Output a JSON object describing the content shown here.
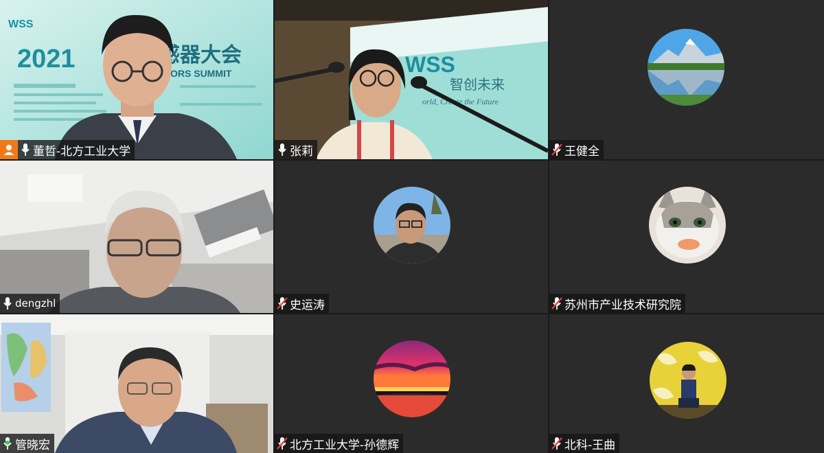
{
  "tiles": [
    {
      "id": "t1",
      "name": "董哲-北方工业大学",
      "mic": "on",
      "host": true,
      "backdrop": {
        "logo": "WSS",
        "year": "2021",
        "title_fragment": "感器大会",
        "subtitle_fragment": "ORS SUMMIT"
      }
    },
    {
      "id": "t2",
      "name": "张莉",
      "mic": "on",
      "backdrop": {
        "logo": "WSS",
        "slogan": "智创未来",
        "slogan_en": "orld, Create the Future"
      }
    },
    {
      "id": "t3",
      "name": "王健全",
      "mic": "muted",
      "avatar": "mountain-lake"
    },
    {
      "id": "t4",
      "name": "dengzhl",
      "mic": "on"
    },
    {
      "id": "t5",
      "name": "史运涛",
      "mic": "muted",
      "avatar": "man-photo"
    },
    {
      "id": "t6",
      "name": "苏州市产业技术研究院",
      "mic": "muted",
      "avatar": "cat"
    },
    {
      "id": "t7",
      "name": "管晓宏",
      "mic": "speaking"
    },
    {
      "id": "t8",
      "name": "北方工业大学-孙德辉",
      "mic": "muted",
      "avatar": "sunset"
    },
    {
      "id": "t9",
      "name": "北科-王曲",
      "mic": "muted",
      "avatar": "person-yellow"
    }
  ],
  "colors": {
    "host_badge": "#f07a1a",
    "tile_bg": "#2b2b2b",
    "speaking_mic": "#37d158",
    "muted_mic": "#e0413a"
  }
}
